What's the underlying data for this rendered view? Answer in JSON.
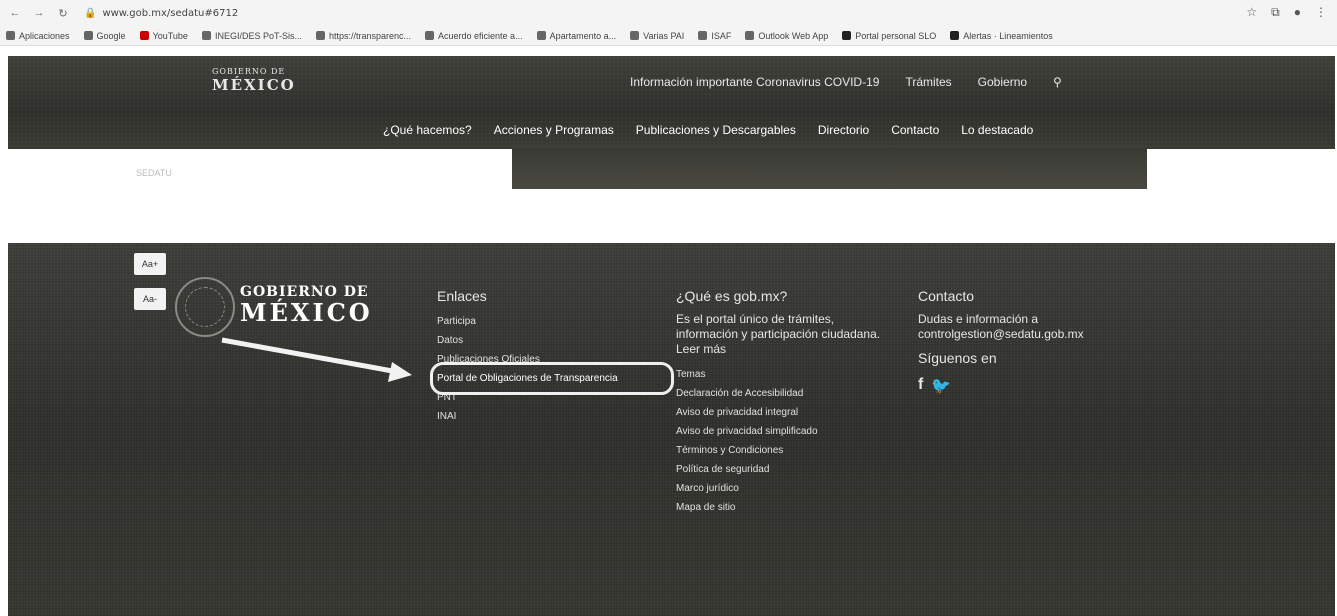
{
  "browser": {
    "url": "www.gob.mx/sedatu#6712",
    "bookmarks": [
      "Aplicaciones",
      "Google",
      "YouTube",
      "INEGI/DES PoT-Sis...",
      "https://transparenc...",
      "Acuerdo eficiente a...",
      "Apartamento a...",
      "Varias PAI",
      "ISAF",
      "Outlook Web App",
      "Portal personal SLO",
      "Alertas · Lineamientos"
    ]
  },
  "header": {
    "logo_small": "GOBIERNO DE",
    "logo_big": "MÉXICO",
    "top_links": [
      "Información importante Coronavirus COVID-19",
      "Trámites",
      "Gobierno"
    ],
    "main_links": [
      "¿Qué hacemos?",
      "Acciones y Programas",
      "Publicaciones y Descargables",
      "Directorio",
      "Contacto",
      "Lo destacado"
    ],
    "faint_text": "SEDATU"
  },
  "footer": {
    "font_plus": "Aa+",
    "font_minus": "Aa-",
    "logo_small": "GOBIERNO DE",
    "logo_big": "MÉXICO",
    "enlaces": {
      "title": "Enlaces",
      "links": [
        "Participa",
        "Datos",
        "Publicaciones Oficiales",
        "Portal de Obligaciones de Transparencia",
        "PNT",
        "INAI"
      ]
    },
    "que_es": {
      "title": "¿Qué es gob.mx?",
      "text": "Es el portal único de trámites, información y participación ciudadana. Leer más",
      "links": [
        "Temas",
        "Declaración de Accesibilidad",
        "Aviso de privacidad integral",
        "Aviso de privacidad simplificado",
        "Términos y Condiciones",
        "Política de seguridad",
        "Marco jurídico",
        "Mapa de sitio"
      ]
    },
    "contacto": {
      "title": "Contacto",
      "text": "Dudas e información a controlgestion@sedatu.gob.mx",
      "follow": "Síguenos en",
      "facebook": "f",
      "twitter": "t"
    }
  }
}
